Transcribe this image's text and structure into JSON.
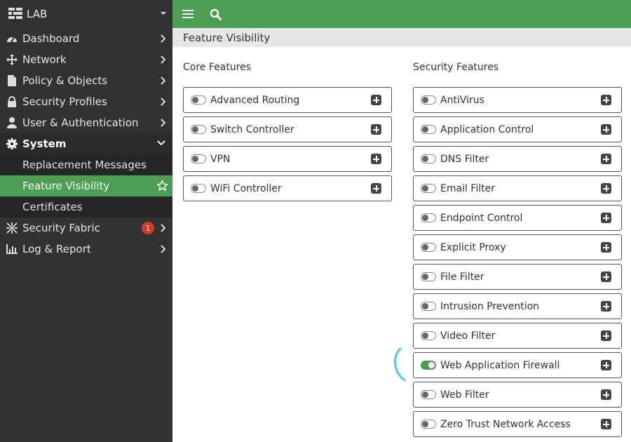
{
  "sidebar": {
    "brand": "LAB",
    "items": [
      {
        "label": "Dashboard",
        "icon": "dashboard-icon"
      },
      {
        "label": "Network",
        "icon": "network-icon"
      },
      {
        "label": "Policy & Objects",
        "icon": "policy-icon"
      },
      {
        "label": "Security Profiles",
        "icon": "lock-icon"
      },
      {
        "label": "User & Authentication",
        "icon": "user-icon"
      },
      {
        "label": "System",
        "icon": "gear-icon"
      }
    ],
    "system_sub": [
      {
        "label": "Replacement Messages"
      },
      {
        "label": "Feature Visibility"
      },
      {
        "label": "Certificates"
      }
    ],
    "items_after": [
      {
        "label": "Security Fabric",
        "icon": "fabric-icon",
        "badge": "1"
      },
      {
        "label": "Log & Report",
        "icon": "chart-icon"
      }
    ]
  },
  "topbar": {
    "menu_icon": "hamburger-icon",
    "search_icon": "search-icon"
  },
  "page": {
    "title": "Feature Visibility"
  },
  "core": {
    "title": "Core Features",
    "features": [
      {
        "label": "Advanced Routing",
        "enabled": false
      },
      {
        "label": "Switch Controller",
        "enabled": false
      },
      {
        "label": "VPN",
        "enabled": false
      },
      {
        "label": "WiFi Controller",
        "enabled": false
      }
    ]
  },
  "security": {
    "title": "Security Features",
    "features": [
      {
        "label": "AntiVirus",
        "enabled": false
      },
      {
        "label": "Application Control",
        "enabled": false
      },
      {
        "label": "DNS Filter",
        "enabled": false
      },
      {
        "label": "Email Filter",
        "enabled": false
      },
      {
        "label": "Endpoint Control",
        "enabled": false
      },
      {
        "label": "Explicit Proxy",
        "enabled": false
      },
      {
        "label": "File Filter",
        "enabled": false
      },
      {
        "label": "Intrusion Prevention",
        "enabled": false
      },
      {
        "label": "Video Filter",
        "enabled": false
      },
      {
        "label": "Web Application Firewall",
        "enabled": true
      },
      {
        "label": "Web Filter",
        "enabled": false
      },
      {
        "label": "Zero Trust Network Access",
        "enabled": false
      }
    ]
  },
  "colors": {
    "accent": "#4e9d55",
    "sidebar": "#323232",
    "badge": "#d33b2c",
    "annotation": "#4fc8e6"
  }
}
